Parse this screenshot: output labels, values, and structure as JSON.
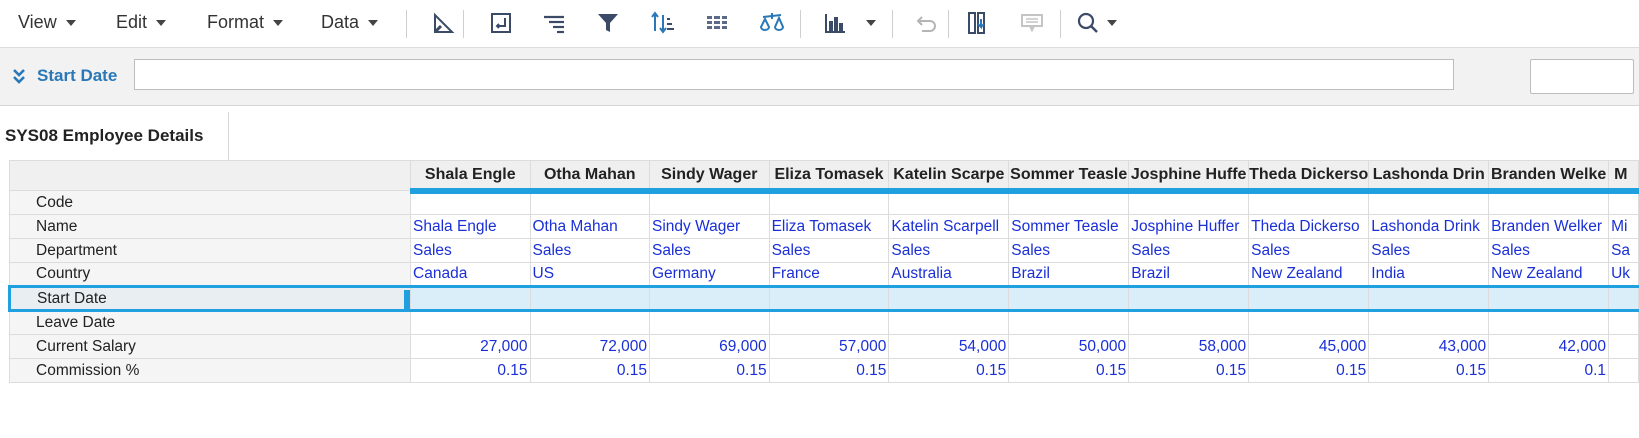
{
  "toolbar": {
    "menus": [
      {
        "label": "View"
      },
      {
        "label": "Edit"
      },
      {
        "label": "Format"
      },
      {
        "label": "Data"
      }
    ],
    "icons": [
      "pivot-icon",
      "cell-edit-icon",
      "sort-lines-icon",
      "filter-icon",
      "sort-icon",
      "table-grid-icon",
      "balance-icon",
      "bar-chart-icon",
      "undo-icon",
      "freeze-columns-icon",
      "comment-icon",
      "search-icon"
    ]
  },
  "filter": {
    "label": "Start Date",
    "value": "",
    "secondary_value": ""
  },
  "sheet": {
    "title": "SYS08 Employee Details"
  },
  "grid": {
    "columns": [
      "Shala Engle",
      "Otha Mahan",
      "Sindy Wager",
      "Eliza Tomasek",
      "Katelin Scarpe",
      "Sommer Teasle",
      "Josphine Huffe",
      "Theda Dickerso",
      "Lashonda Drin",
      "Branden Welke",
      "M"
    ],
    "row_labels": {
      "code": "Code",
      "name": "Name",
      "department": "Department",
      "country": "Country",
      "start_date": "Start Date",
      "leave_date": "Leave Date",
      "salary": "Current Salary",
      "commission": "Commission %"
    },
    "names": [
      "Shala Engle",
      "Otha Mahan",
      "Sindy Wager",
      "Eliza Tomasek",
      "Katelin Scarpell",
      "Sommer Teasle",
      "Josphine Huffer",
      "Theda Dickerso",
      "Lashonda Drink",
      "Branden Welker",
      "Mi"
    ],
    "departments": [
      "Sales",
      "Sales",
      "Sales",
      "Sales",
      "Sales",
      "Sales",
      "Sales",
      "Sales",
      "Sales",
      "Sales",
      "Sa"
    ],
    "countries": [
      "Canada",
      "US",
      "Germany",
      "France",
      "Australia",
      "Brazil",
      "Brazil",
      "New Zealand",
      "India",
      "New Zealand",
      "Uk"
    ],
    "salaries": [
      "27,000",
      "72,000",
      "69,000",
      "57,000",
      "54,000",
      "50,000",
      "58,000",
      "45,000",
      "43,000",
      "42,000",
      ""
    ],
    "commissions": [
      "0.15",
      "0.15",
      "0.15",
      "0.15",
      "0.15",
      "0.15",
      "0.15",
      "0.15",
      "0.15",
      "0.1",
      ""
    ]
  },
  "colors": {
    "accent": "#21a0df",
    "value_text": "#1a2fd6",
    "filter_label": "#2a78b8"
  }
}
